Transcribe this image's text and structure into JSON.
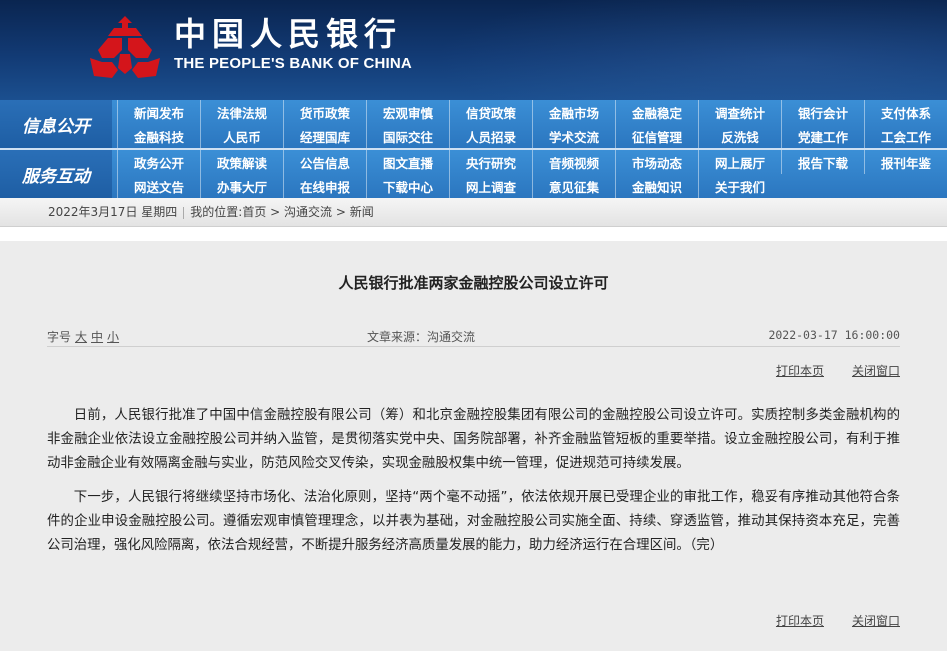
{
  "header": {
    "cn_name": "中国人民银行",
    "en_name": "THE PEOPLE'S BANK OF CHINA",
    "logo_icon": "pboc-emblem-icon",
    "colors": {
      "banner": "#123a74",
      "nav": "#2f7fc6",
      "logo_red": "#d4151b"
    }
  },
  "nav": {
    "section1_title": "信息公开",
    "section2_title": "服务互动",
    "section1_items": [
      "新闻发布",
      "法律法规",
      "货币政策",
      "宏观审慎",
      "信贷政策",
      "金融市场",
      "金融稳定",
      "调查统计",
      "银行会计",
      "支付体系",
      "金融科技",
      "人民币",
      "经理国库",
      "国际交往",
      "人员招录",
      "学术交流",
      "征信管理",
      "反洗钱",
      "党建工作",
      "工会工作"
    ],
    "section2_items": [
      "政务公开",
      "政策解读",
      "公告信息",
      "图文直播",
      "央行研究",
      "音频视频",
      "市场动态",
      "网上展厅",
      "报告下载",
      "报刊年鉴",
      "网送文告",
      "办事大厅",
      "在线申报",
      "下载中心",
      "网上调查",
      "意见征集",
      "金融知识",
      "关于我们"
    ]
  },
  "breadcrumb": {
    "date": "2022年3月17日 星期四",
    "prefix": "我的位置:",
    "home": "首页",
    "sep1": ">",
    "level1": "沟通交流",
    "sep2": ">",
    "level2": "新闻"
  },
  "article": {
    "title": "人民银行批准两家金融控股公司设立许可",
    "font_size_label": "字号",
    "size_large": "大",
    "size_medium": "中",
    "size_small": "小",
    "source": "文章来源：沟通交流",
    "datetime": "2022-03-17 16:00:00",
    "print_label": "打印本页",
    "close_label": "关闭窗口",
    "paragraphs": [
      "日前，人民银行批准了中国中信金融控股有限公司（筹）和北京金融控股集团有限公司的金融控股公司设立许可。实质控制多类金融机构的非金融企业依法设立金融控股公司并纳入监管，是贯彻落实党中央、国务院部署，补齐金融监管短板的重要举措。设立金融控股公司，有利于推动非金融企业有效隔离金融与实业，防范风险交叉传染，实现金融股权集中统一管理，促进规范可持续发展。",
      "下一步，人民银行将继续坚持市场化、法治化原则，坚持“两个毫不动摇”，依法依规开展已受理企业的审批工作，稳妥有序推动其他符合条件的企业申设金融控股公司。遵循宏观审慎管理理念，以并表为基础，对金融控股公司实施全面、持续、穿透监管，推动其保持资本充足，完善公司治理，强化风险隔离，依法合规经营，不断提升服务经济高质量发展的能力，助力经济运行在合理区间。（完）"
    ]
  }
}
